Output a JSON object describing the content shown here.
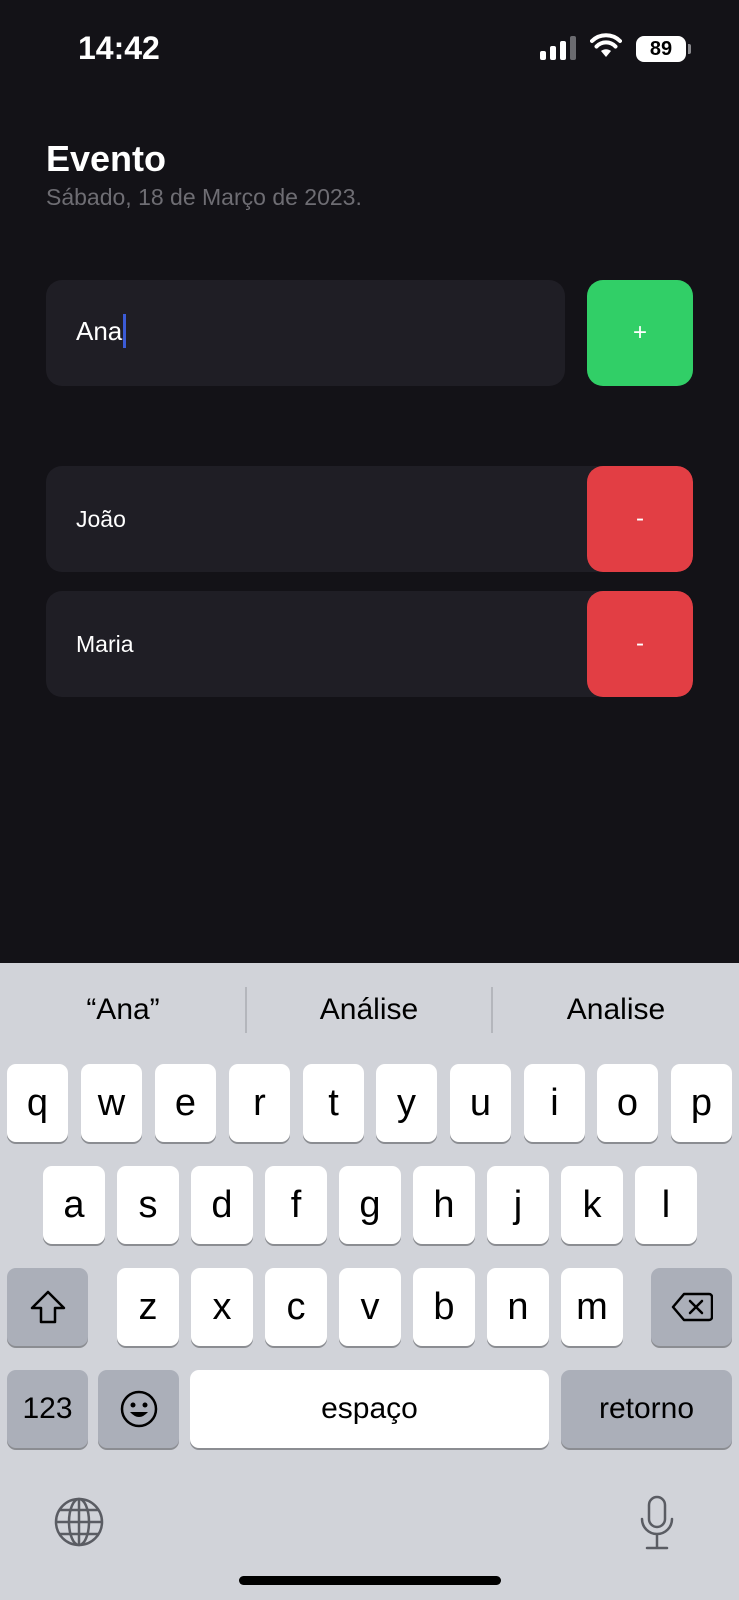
{
  "status_bar": {
    "time": "14:42",
    "battery": "89"
  },
  "header": {
    "title": "Evento",
    "subtitle": "Sábado, 18 de Março de 2023."
  },
  "input": {
    "value": "Ana",
    "add_label": "+"
  },
  "participants": [
    {
      "name": "João",
      "remove_label": "-"
    },
    {
      "name": "Maria",
      "remove_label": "-"
    }
  ],
  "keyboard": {
    "suggestions": [
      "“Ana”",
      "Análise",
      "Analise"
    ],
    "row1": [
      "q",
      "w",
      "e",
      "r",
      "t",
      "y",
      "u",
      "i",
      "o",
      "p"
    ],
    "row2": [
      "a",
      "s",
      "d",
      "f",
      "g",
      "h",
      "j",
      "k",
      "l"
    ],
    "row3": [
      "z",
      "x",
      "c",
      "v",
      "b",
      "n",
      "m"
    ],
    "numbers_label": "123",
    "space_label": "espaço",
    "return_label": "retorno"
  },
  "colors": {
    "background": "#131217",
    "card": "#1f1e25",
    "add": "#31cf67",
    "remove": "#e23e44",
    "keyboard": "#d1d3d9"
  }
}
